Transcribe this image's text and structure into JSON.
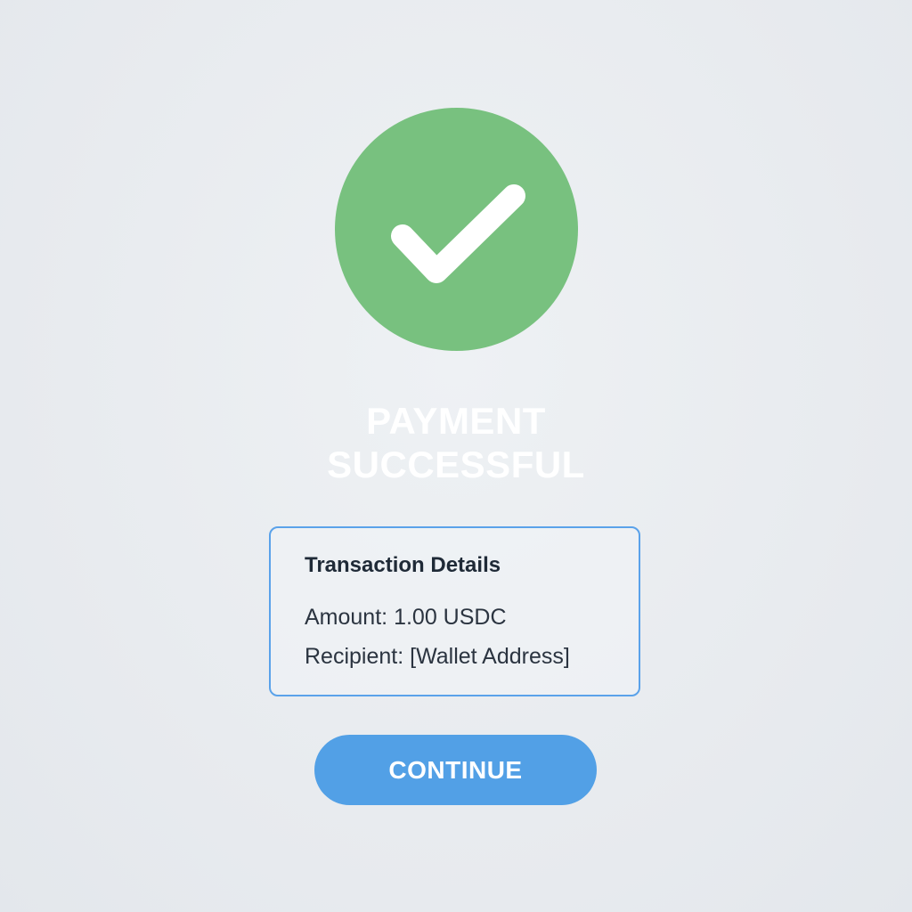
{
  "status": {
    "icon": "checkmark-icon",
    "color": "#78c17f",
    "title_line1": "PAYMENT",
    "title_line2": "SUCCESSFUL"
  },
  "transaction": {
    "heading": "Transaction Details",
    "amount_label": "Amount:",
    "amount_value": "1.00 USDC",
    "recipient_label": "Recipient:",
    "recipient_value": "[Wallet Address]",
    "border_color": "#5aa2ea"
  },
  "actions": {
    "continue_label": "CONTINUE",
    "continue_color": "#52a0e6"
  }
}
